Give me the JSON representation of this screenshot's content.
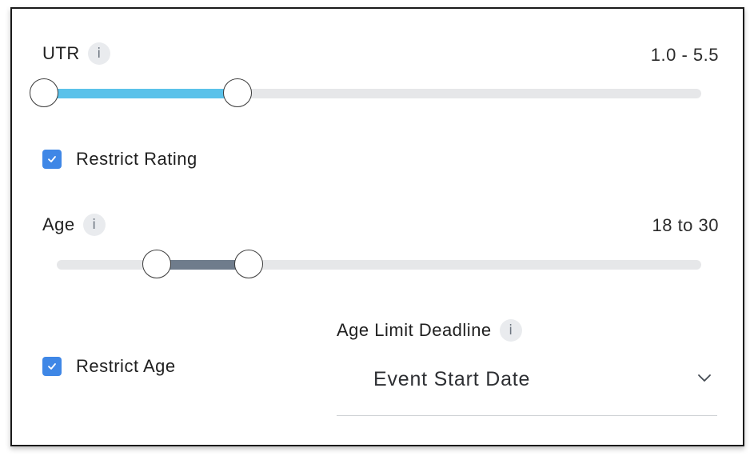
{
  "utr": {
    "label": "UTR",
    "info_icon": "info-icon",
    "range_text": "1.0 - 5.5",
    "selected_low_fraction": 0.0,
    "selected_high_fraction": 0.295,
    "fill_color": "#5bc2ea"
  },
  "restrict_rating": {
    "label": "Restrict Rating",
    "checked": true
  },
  "age": {
    "label": "Age",
    "info_icon": "info-icon",
    "range_text": "18 to 30",
    "selected_low_fraction": 0.155,
    "selected_high_fraction": 0.298,
    "fill_color": "#6f7c8c"
  },
  "restrict_age": {
    "label": "Restrict Age",
    "checked": true
  },
  "age_limit_deadline": {
    "label": "Age Limit Deadline",
    "info_icon": "info-icon",
    "selected_value": "Event Start Date",
    "dropdown_icon": "chevron-down-icon"
  },
  "colors": {
    "checkbox": "#3f87e6",
    "track": "#e6e7e9"
  }
}
